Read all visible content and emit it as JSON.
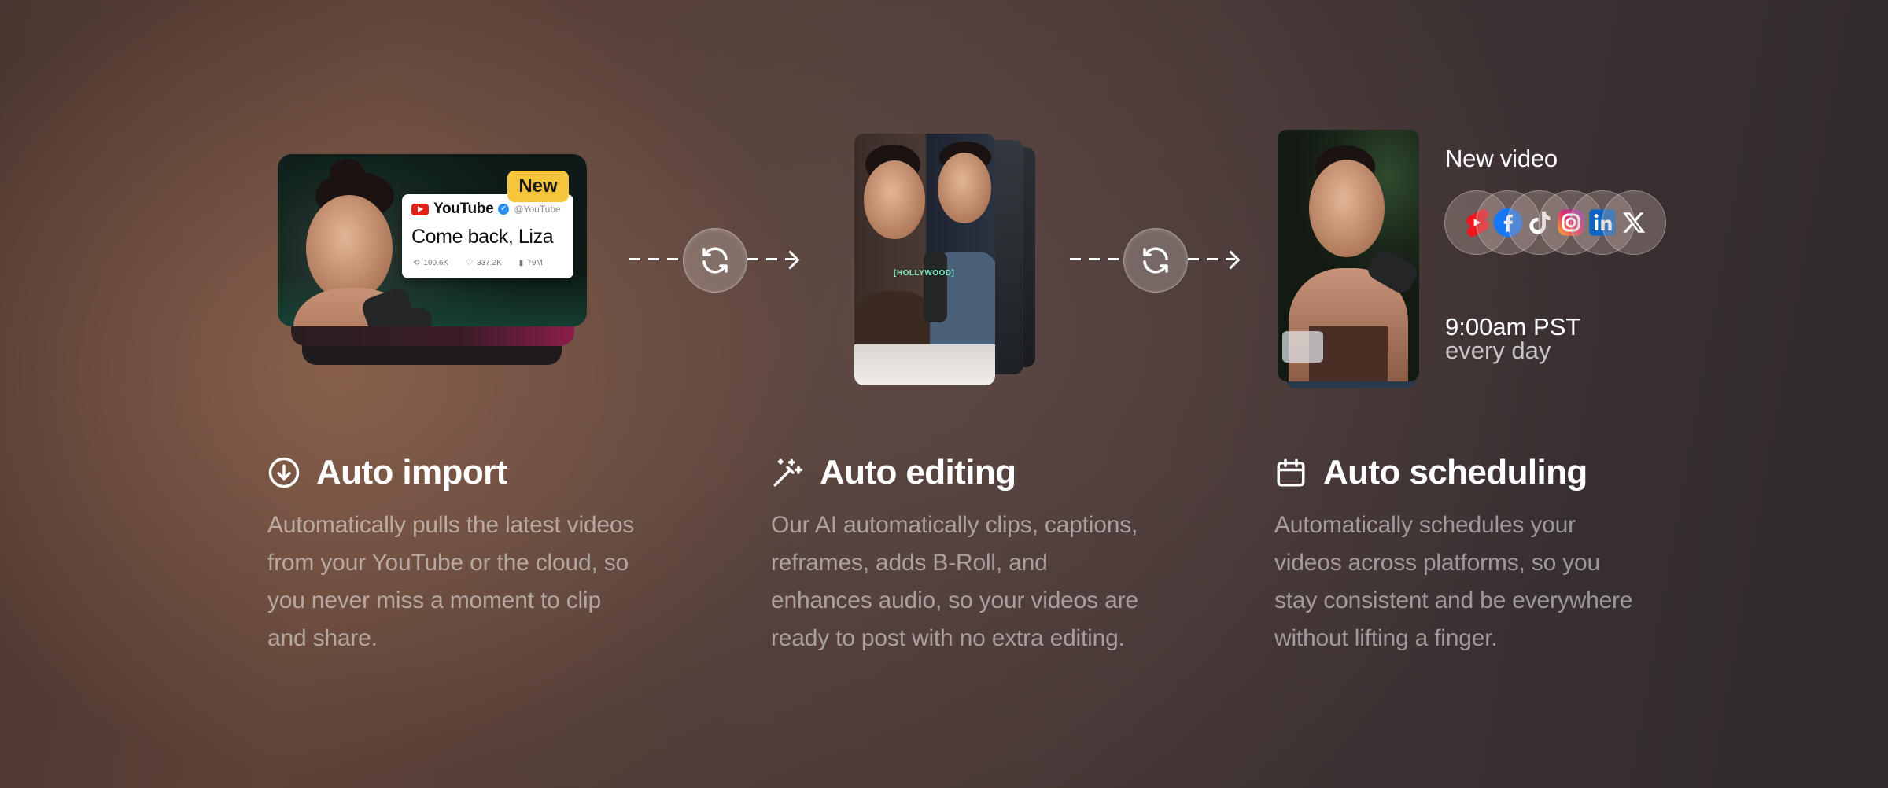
{
  "steps": {
    "import": {
      "title": "Auto import",
      "description": "Automatically pulls the latest videos from your YouTube or the cloud, so you never miss a moment to clip and share.",
      "icon": "download-circle-icon",
      "card": {
        "badge": "New",
        "channel": "YouTube",
        "handle": "@YouTube",
        "post_text": "Come back, Liza",
        "reposts": "100.6K",
        "likes": "337.2K",
        "views": "79M"
      }
    },
    "editing": {
      "title": "Auto editing",
      "description": "Our AI automatically clips, captions, reframes, adds B-Roll, and enhances audio, so your videos are ready to post with no extra editing.",
      "icon": "magic-wand-icon",
      "caption": "HOLLYWOOD"
    },
    "scheduling": {
      "title": "Auto scheduling",
      "description": "Automatically schedules your videos across platforms, so you stay consistent and be everywhere without lifting a finger.",
      "icon": "calendar-icon",
      "new_video_label": "New video",
      "time": "9:00am PST",
      "frequency": "every day",
      "platforms": [
        "youtube-shorts-icon",
        "facebook-icon",
        "tiktok-icon",
        "instagram-icon",
        "linkedin-icon",
        "x-icon"
      ]
    }
  },
  "colors": {
    "badge": "#f5c53a",
    "youtube_red": "#e62117",
    "caption_green": "#7df0c6"
  }
}
